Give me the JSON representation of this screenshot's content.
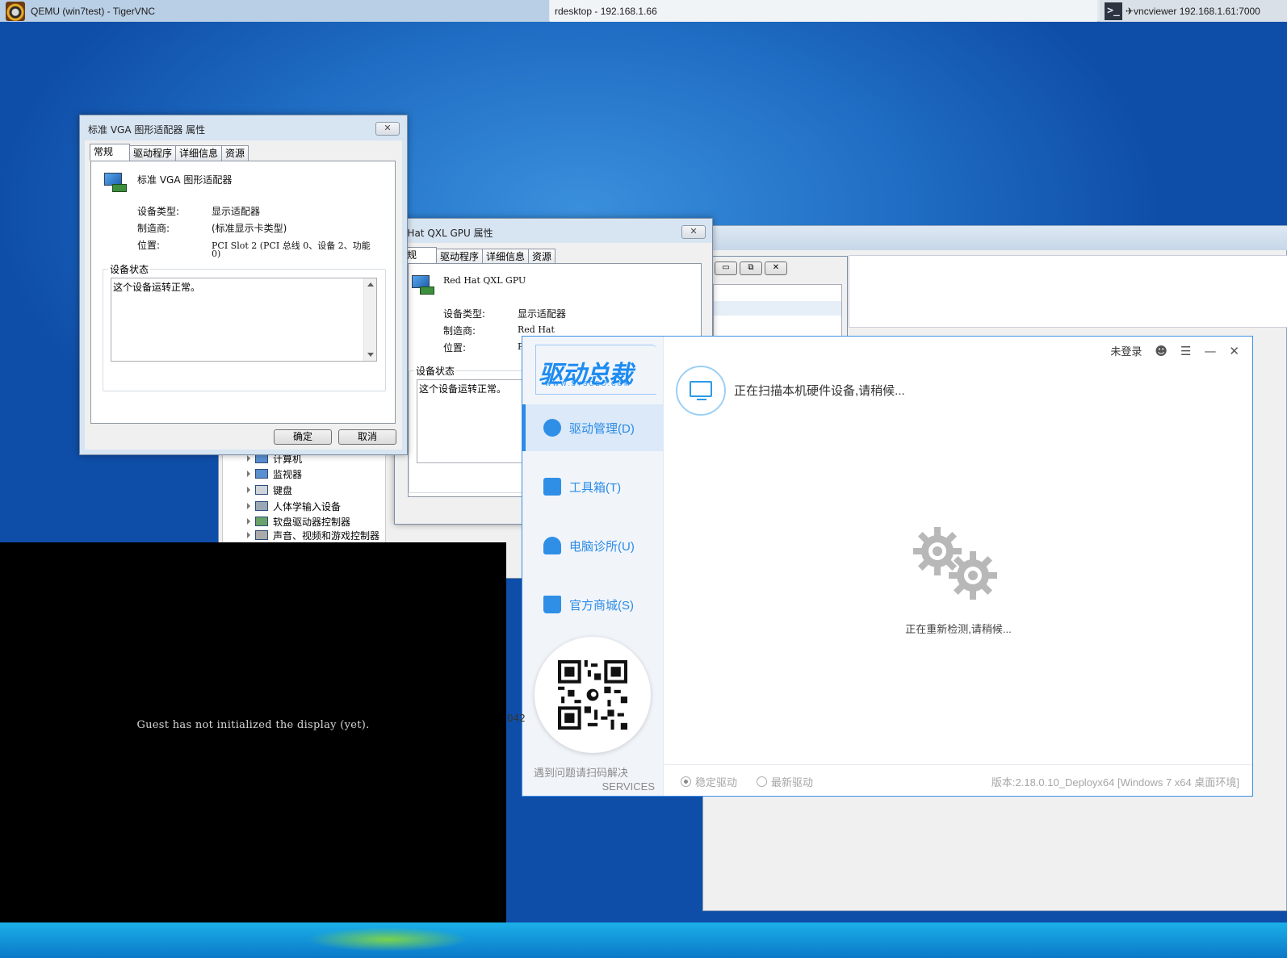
{
  "hostbar": {
    "task1": "QEMU (win7test) - TigerVNC",
    "task2": "rdesktop - 192.168.1.66",
    "task3": "✈vncviewer 192.168.1.61:7000"
  },
  "vga_props": {
    "title": "标准 VGA 图形适配器 属性",
    "close": "✕",
    "tabs": [
      "常规",
      "驱动程序",
      "详细信息",
      "资源"
    ],
    "device_name": "标准 VGA 图形适配器",
    "type_label": "设备类型:",
    "type_value": "显示适配器",
    "vendor_label": "制造商:",
    "vendor_value": "(标准显示卡类型)",
    "location_label": "位置:",
    "location_value_1": "PCI Slot 2 (PCI 总线 0、设备 2、功能",
    "location_value_2": "0)",
    "status_caption": "设备状态",
    "status_text": "这个设备运转正常。",
    "ok": "确定",
    "cancel": "取消"
  },
  "qxl_props": {
    "title": "d Hat QXL GPU 属性",
    "close": "✕",
    "tabs": [
      "常规",
      "驱动程序",
      "详细信息",
      "资源"
    ],
    "tab0_partial": "规",
    "device_name": "Red Hat QXL GPU",
    "type_label": "设备类型:",
    "type_value": "显示适配器",
    "vendor_label": "制造商:",
    "vendor_value": "Red Hat",
    "location_label": "位置:",
    "location_value": "P",
    "status_caption": "设备状态",
    "status_text": "这个设备运转正常。"
  },
  "device_tree": {
    "items": [
      "计算机",
      "监视器",
      "键盘",
      "人体学输入设备",
      "软盘驱动器控制器",
      "声音、视频和游戏控制器"
    ]
  },
  "small_window": {
    "min": "▭",
    "max": "⧉",
    "close": "✕"
  },
  "guest": {
    "message": "Guest has not initialized the display (yet).",
    "side_fragment": "042"
  },
  "driver_app": {
    "logo": "驱动总裁",
    "logo_sub": "WWW.SYSCEO.COM",
    "login": "未登录",
    "nav": [
      {
        "label": "驱动管理(D)",
        "icon": "gear-icon"
      },
      {
        "label": "工具箱(T)",
        "icon": "toolbox-icon"
      },
      {
        "label": "电脑诊所(U)",
        "icon": "person-icon"
      },
      {
        "label": "官方商城(S)",
        "icon": "shopping-bag-icon"
      }
    ],
    "scan_text": "正在扫描本机硬件设备,请稍候...",
    "redetect_text": "正在重新检测,请稍候...",
    "qr_caption": "遇到问题请扫码解决",
    "qr_caption_en": "SERVICES",
    "radio_stable": "稳定驱动",
    "radio_latest": "最新驱动",
    "version": "版本:2.18.0.10_Deployx64 [Windows 7 x64 桌面环境]",
    "accent": "#2b8be6"
  }
}
